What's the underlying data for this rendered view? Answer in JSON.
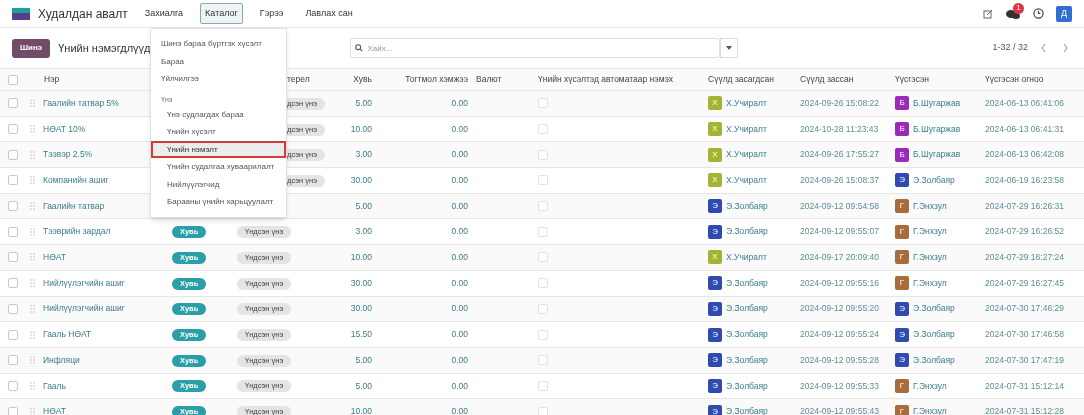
{
  "topbar": {
    "app_name": "Худалдан авалт",
    "menu": [
      {
        "label": "Захиалга",
        "selected": false
      },
      {
        "label": "Каталог",
        "selected": true
      },
      {
        "label": "Гэрээ",
        "selected": false
      },
      {
        "label": "Лавлах сан",
        "selected": false
      }
    ],
    "chat_count": "1",
    "user_initial": "Д"
  },
  "dropdown": {
    "items": [
      {
        "kind": "item",
        "label": "Шинэ бараа бүртгэх хүсэлт",
        "selected": false
      },
      {
        "kind": "item",
        "label": "Бараа",
        "selected": false
      },
      {
        "kind": "item",
        "label": "Үйлчилгээ",
        "selected": false
      },
      {
        "kind": "section",
        "label": "Үнэ"
      },
      {
        "kind": "subitem",
        "label": "Үнэ судлагдах бараа",
        "selected": false
      },
      {
        "kind": "subitem",
        "label": "Үнийн хүсэлт",
        "selected": false
      },
      {
        "kind": "subitem",
        "label": "Үнийн нэмэлт",
        "selected": true
      },
      {
        "kind": "subitem",
        "label": "Үнийн судалгаа хуваарилалт",
        "selected": false
      },
      {
        "kind": "subitem",
        "label": "Нийлүүлэгчид",
        "selected": false
      },
      {
        "kind": "subitem",
        "label": "Барааны үнийн харьцуулалт",
        "selected": false
      }
    ]
  },
  "control_bar": {
    "new_button": "Шинэ",
    "title": "Үнийн нэмэгдлүүд",
    "search": {
      "placeholder": "Хайх..."
    },
    "pager": "1-32 / 32"
  },
  "table": {
    "select_all": false,
    "columns": [
      "Нэр",
      "терел",
      "Хувь",
      "Тогтмол хэмжээ",
      "Валют",
      "Үнийн хүсэлтэд автоматаар нэмэх",
      "Сүүлд засагдсан",
      "Сүүлд зассан",
      "Үүсгэсэн",
      "Үүсгэсэн огноо"
    ],
    "rows": [
      {
        "checked": false,
        "name": "Гаалийн татвар 5%",
        "type_badge": null,
        "base_badge": {
          "kind": "partial",
          "text": "дсэн үнэ"
        },
        "percent": "5.00",
        "fixed": "0.00",
        "auto_add": false,
        "modified_by": {
          "initial": "Х",
          "name": "Х.Учиралт",
          "color": "#a5b332"
        },
        "modified": "2024-09-26 15:08:22",
        "created_by": {
          "initial": "Б",
          "name": "Б.Шугаржав",
          "color": "#9c2ab8"
        },
        "created": "2024-06-13 06:41:06"
      },
      {
        "checked": false,
        "name": "НӨАТ 10%",
        "type_badge": null,
        "base_badge": {
          "kind": "partial",
          "text": "дсэн үнэ"
        },
        "percent": "10.00",
        "fixed": "0.00",
        "auto_add": false,
        "modified_by": {
          "initial": "Х",
          "name": "Х.Учиралт",
          "color": "#a5b332"
        },
        "modified": "2024-10-28 11:23:43",
        "created_by": {
          "initial": "Б",
          "name": "Б.Шугаржав",
          "color": "#9c2ab8"
        },
        "created": "2024-06-13 06:41:31"
      },
      {
        "checked": false,
        "name": "Тээвэр 2.5%",
        "type_badge": null,
        "base_badge": {
          "kind": "partial",
          "text": "дсэн үнэ"
        },
        "percent": "3.00",
        "fixed": "0.00",
        "auto_add": false,
        "modified_by": {
          "initial": "Х",
          "name": "Х.Учиралт",
          "color": "#a5b332"
        },
        "modified": "2024-09-26 17:55:27",
        "created_by": {
          "initial": "Б",
          "name": "Б.Шугаржав",
          "color": "#9c2ab8"
        },
        "created": "2024-06-13 06:42:08"
      },
      {
        "checked": false,
        "name": "Компанийн ашиг",
        "type_badge": null,
        "base_badge": {
          "kind": "partial",
          "text": "дсэн үнэ"
        },
        "percent": "30.00",
        "fixed": "0.00",
        "auto_add": false,
        "modified_by": {
          "initial": "Х",
          "name": "Х.Учиралт",
          "color": "#a5b332"
        },
        "modified": "2024-09-26 15:08:37",
        "created_by": {
          "initial": "Э",
          "name": "Э.Золбаяр",
          "color": "#2f4bb0"
        },
        "created": "2024-06-19 16:23:58"
      },
      {
        "checked": false,
        "name": "Гаалийн татвар",
        "type_badge": null,
        "base_badge": null,
        "percent": "5.00",
        "fixed": "0.00",
        "auto_add": false,
        "modified_by": {
          "initial": "Э",
          "name": "Э.Золбаяр",
          "color": "#2f4bb0"
        },
        "modified": "2024-09-12 09:54:58",
        "created_by": {
          "initial": "Г",
          "name": "Г.Энхзул",
          "color": "#a86b3c"
        },
        "created": "2024-07-29 16:26:31"
      },
      {
        "checked": false,
        "name": "Тээврийн зардал",
        "type_badge": "Хувь",
        "base_badge": {
          "kind": "full",
          "text": "Үндсэн үнэ"
        },
        "percent": "3.00",
        "fixed": "0.00",
        "auto_add": false,
        "modified_by": {
          "initial": "Э",
          "name": "Э.Золбаяр",
          "color": "#2f4bb0"
        },
        "modified": "2024-09-12 09:55:07",
        "created_by": {
          "initial": "Г",
          "name": "Г.Энхзул",
          "color": "#a86b3c"
        },
        "created": "2024-07-29 16:26:52"
      },
      {
        "checked": false,
        "name": "НӨАТ",
        "type_badge": "Хувь",
        "base_badge": {
          "kind": "full",
          "text": "Үндсэн үнэ"
        },
        "percent": "10.00",
        "fixed": "0.00",
        "auto_add": false,
        "modified_by": {
          "initial": "Х",
          "name": "Х.Учиралт",
          "color": "#a5b332"
        },
        "modified": "2024-09-17 20:09:40",
        "created_by": {
          "initial": "Г",
          "name": "Г.Энхзул",
          "color": "#a86b3c"
        },
        "created": "2024-07-29 16:27:24"
      },
      {
        "checked": false,
        "name": "Нийлүүлэгчийн ашиг",
        "type_badge": "Хувь",
        "base_badge": {
          "kind": "full",
          "text": "Үндсэн үнэ"
        },
        "percent": "30.00",
        "fixed": "0.00",
        "auto_add": false,
        "modified_by": {
          "initial": "Э",
          "name": "Э.Золбаяр",
          "color": "#2f4bb0"
        },
        "modified": "2024-09-12 09:55:16",
        "created_by": {
          "initial": "Г",
          "name": "Г.Энхзул",
          "color": "#a86b3c"
        },
        "created": "2024-07-29 16:27:45"
      },
      {
        "checked": false,
        "name": "Нийлүүлэгчийн ашиг",
        "type_badge": "Хувь",
        "base_badge": {
          "kind": "full",
          "text": "Үндсэн үнэ"
        },
        "percent": "30.00",
        "fixed": "0.00",
        "auto_add": false,
        "modified_by": {
          "initial": "Э",
          "name": "Э.Золбаяр",
          "color": "#2f4bb0"
        },
        "modified": "2024-09-12 09:55:20",
        "created_by": {
          "initial": "Э",
          "name": "Э.Золбаяр",
          "color": "#2f4bb0"
        },
        "created": "2024-07-30 17:46:29"
      },
      {
        "checked": false,
        "name": "Гааль НӨАТ",
        "type_badge": "Хувь",
        "base_badge": {
          "kind": "full",
          "text": "Үндсэн үнэ"
        },
        "percent": "15.50",
        "fixed": "0.00",
        "auto_add": false,
        "modified_by": {
          "initial": "Э",
          "name": "Э.Золбаяр",
          "color": "#2f4bb0"
        },
        "modified": "2024-09-12 09:55:24",
        "created_by": {
          "initial": "Э",
          "name": "Э.Золбаяр",
          "color": "#2f4bb0"
        },
        "created": "2024-07-30 17:46:58"
      },
      {
        "checked": false,
        "name": "Инфляци",
        "type_badge": "Хувь",
        "base_badge": {
          "kind": "full",
          "text": "Үндсэн үнэ"
        },
        "percent": "5.00",
        "fixed": "0.00",
        "auto_add": false,
        "modified_by": {
          "initial": "Э",
          "name": "Э.Золбаяр",
          "color": "#2f4bb0"
        },
        "modified": "2024-09-12 09:55:28",
        "created_by": {
          "initial": "Э",
          "name": "Э.Золбаяр",
          "color": "#2f4bb0"
        },
        "created": "2024-07-30 17:47:19"
      },
      {
        "checked": false,
        "name": "Гааль",
        "type_badge": "Хувь",
        "base_badge": {
          "kind": "full",
          "text": "Үндсэн үнэ"
        },
        "percent": "5.00",
        "fixed": "0.00",
        "auto_add": false,
        "modified_by": {
          "initial": "Э",
          "name": "Э.Золбаяр",
          "color": "#2f4bb0"
        },
        "modified": "2024-09-12 09:55:33",
        "created_by": {
          "initial": "Г",
          "name": "Г.Энхзул",
          "color": "#a86b3c"
        },
        "created": "2024-07-31 15:12:14"
      },
      {
        "checked": false,
        "name": "НӨАТ",
        "type_badge": "Хувь",
        "base_badge": {
          "kind": "full",
          "text": "Үндсэн үнэ"
        },
        "percent": "10.00",
        "fixed": "0.00",
        "auto_add": false,
        "modified_by": {
          "initial": "Э",
          "name": "Э.Золбаяр",
          "color": "#2f4bb0"
        },
        "modified": "2024-09-12 09:55:43",
        "created_by": {
          "initial": "Г",
          "name": "Г.Энхзул",
          "color": "#a86b3c"
        },
        "created": "2024-07-31 15:12:28"
      }
    ]
  }
}
